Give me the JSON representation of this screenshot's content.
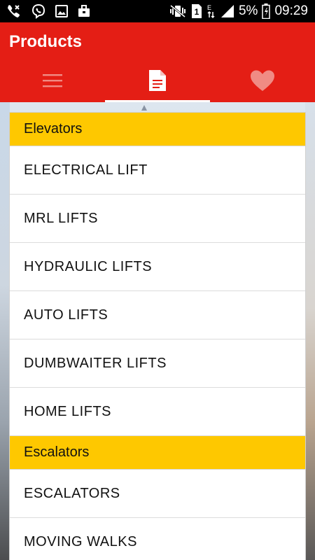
{
  "status_bar": {
    "battery_percent": "5%",
    "time": "09:29",
    "sim_label": "1",
    "network_label": "E",
    "left_icons": [
      "phone-wifi-icon",
      "viber-icon",
      "gallery-icon",
      "briefcase-icon"
    ],
    "right_icons": [
      "vibrate-mute-icon",
      "sim-icon",
      "network-e-icon",
      "signal-icon",
      "battery-icon"
    ]
  },
  "app_bar": {
    "title": "Products",
    "tabs": [
      {
        "icon": "menu-icon",
        "active": false
      },
      {
        "icon": "document-icon",
        "active": true
      },
      {
        "icon": "heart-icon",
        "active": false
      }
    ],
    "color": "#e41e15"
  },
  "sections": [
    {
      "header": "Elevators",
      "items": [
        "ELECTRICAL LIFT",
        "MRL LIFTS",
        "HYDRAULIC LIFTS",
        "AUTO LIFTS",
        "DUMBWAITER LIFTS",
        "HOME LIFTS"
      ]
    },
    {
      "header": "Escalators",
      "items": [
        "ESCALATORS",
        "MOVING WALKS"
      ]
    }
  ],
  "colors": {
    "header_bg": "#fec800",
    "accent": "#e41e15"
  }
}
